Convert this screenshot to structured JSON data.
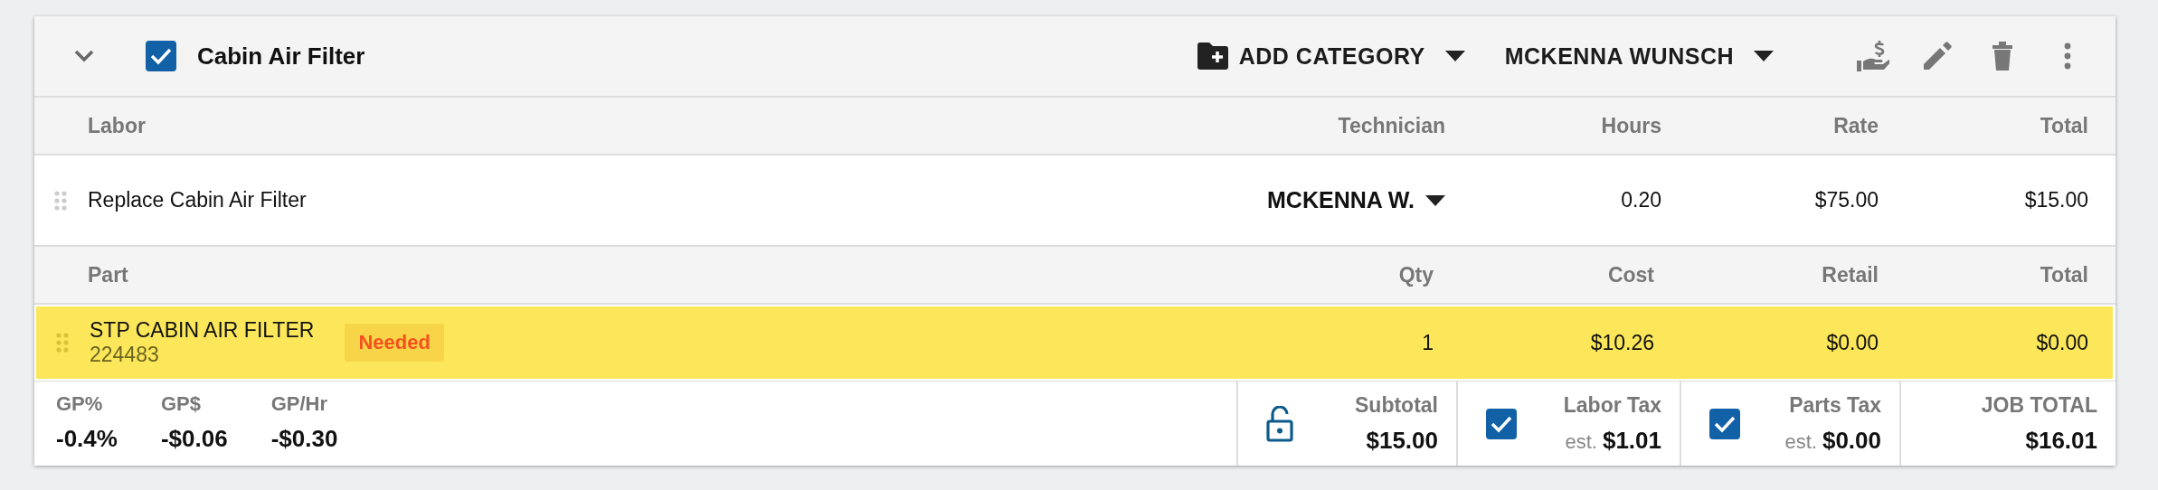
{
  "job": {
    "title": "Cabin Air Filter",
    "checked": true,
    "expanded": true
  },
  "toolbar": {
    "add_category": "ADD CATEGORY",
    "technician": "MCKENNA WUNSCH"
  },
  "labor": {
    "columns": [
      "Labor",
      "Technician",
      "Hours",
      "Rate",
      "Total"
    ],
    "rows": [
      {
        "description": "Replace Cabin Air Filter",
        "technician": "MCKENNA W.",
        "hours": "0.20",
        "rate": "$75.00",
        "total": "$15.00"
      }
    ]
  },
  "parts": {
    "columns": [
      "Part",
      "Qty",
      "Cost",
      "Retail",
      "Total"
    ],
    "rows": [
      {
        "name": "STP CABIN AIR FILTER",
        "number": "224483",
        "status": "Needed",
        "highlighted": true,
        "qty": "1",
        "cost": "$10.26",
        "retail": "$0.00",
        "total": "$0.00"
      }
    ]
  },
  "footer": {
    "gp": [
      {
        "label": "GP%",
        "value": "-0.4%"
      },
      {
        "label": "GP$",
        "value": "-$0.06"
      },
      {
        "label": "GP/Hr",
        "value": "-$0.30"
      }
    ],
    "subtotal": {
      "label": "Subtotal",
      "value": "$15.00",
      "locked": false
    },
    "taxes": [
      {
        "label": "Labor Tax",
        "prefix": "est.",
        "value": "$1.01",
        "checked": true
      },
      {
        "label": "Parts Tax",
        "prefix": "est.",
        "value": "$0.00",
        "checked": true
      }
    ],
    "job_total": {
      "label": "JOB TOTAL",
      "value": "$16.01"
    }
  }
}
